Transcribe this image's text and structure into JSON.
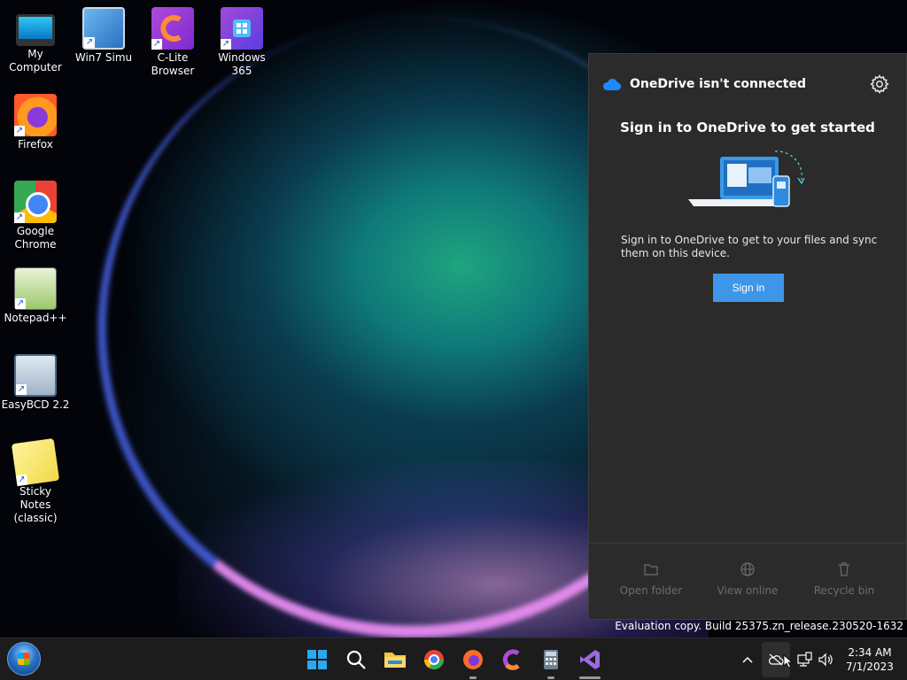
{
  "desktop": {
    "icons": [
      {
        "label": "My Computer"
      },
      {
        "label": "Win7 Simu"
      },
      {
        "label": "C-Lite Browser"
      },
      {
        "label": "Windows 365"
      },
      {
        "label": "Firefox"
      },
      {
        "label": "Google Chrome"
      },
      {
        "label": "Notepad++"
      },
      {
        "label": "EasyBCD 2.2"
      },
      {
        "label": "Sticky Notes (classic)"
      }
    ]
  },
  "onedrive": {
    "title": "OneDrive isn't connected",
    "heading": "Sign in to OneDrive to get started",
    "description": "Sign in to OneDrive to get to your files and sync them on this device.",
    "signin_label": "Sign in",
    "footer": {
      "open_folder": "Open folder",
      "view_online": "View online",
      "recycle_bin": "Recycle bin"
    }
  },
  "watermark": "Evaluation copy. Build 25375.zn_release.230520-1632",
  "clock": {
    "time": "2:34 AM",
    "date": "7/1/2023"
  },
  "colors": {
    "accent": "#3e96e8",
    "flyout_bg": "#2b2b2b",
    "taskbar_bg": "#1c1c1c"
  }
}
